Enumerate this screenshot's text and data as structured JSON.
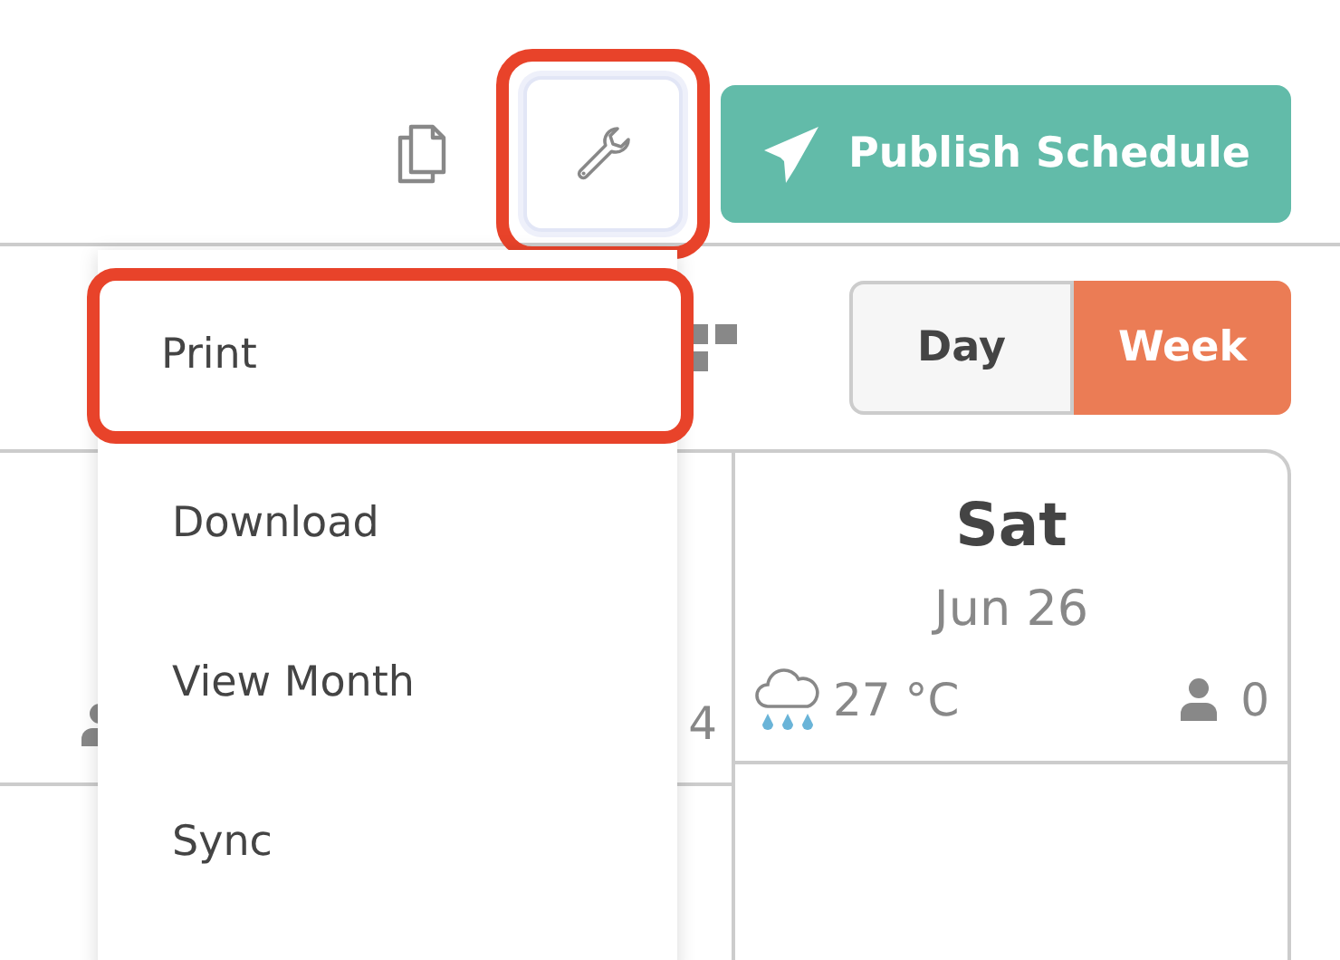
{
  "toolbar": {
    "tools_button": {
      "highlighted": true
    },
    "publish_button": {
      "label": "Publish Schedule"
    }
  },
  "view_toggle": [
    {
      "label": "Day",
      "selected": false
    },
    {
      "label": "Week",
      "selected": true
    }
  ],
  "partial_day": {
    "count": "4"
  },
  "day": {
    "name": "Sat",
    "date": "Jun 26",
    "temperature": "27 °C",
    "count": "0"
  },
  "tools_menu": [
    {
      "label": "Print",
      "highlighted": true
    },
    {
      "label": "Download",
      "highlighted": false
    },
    {
      "label": "View Month",
      "highlighted": false
    },
    {
      "label": "Sync",
      "highlighted": false
    }
  ]
}
